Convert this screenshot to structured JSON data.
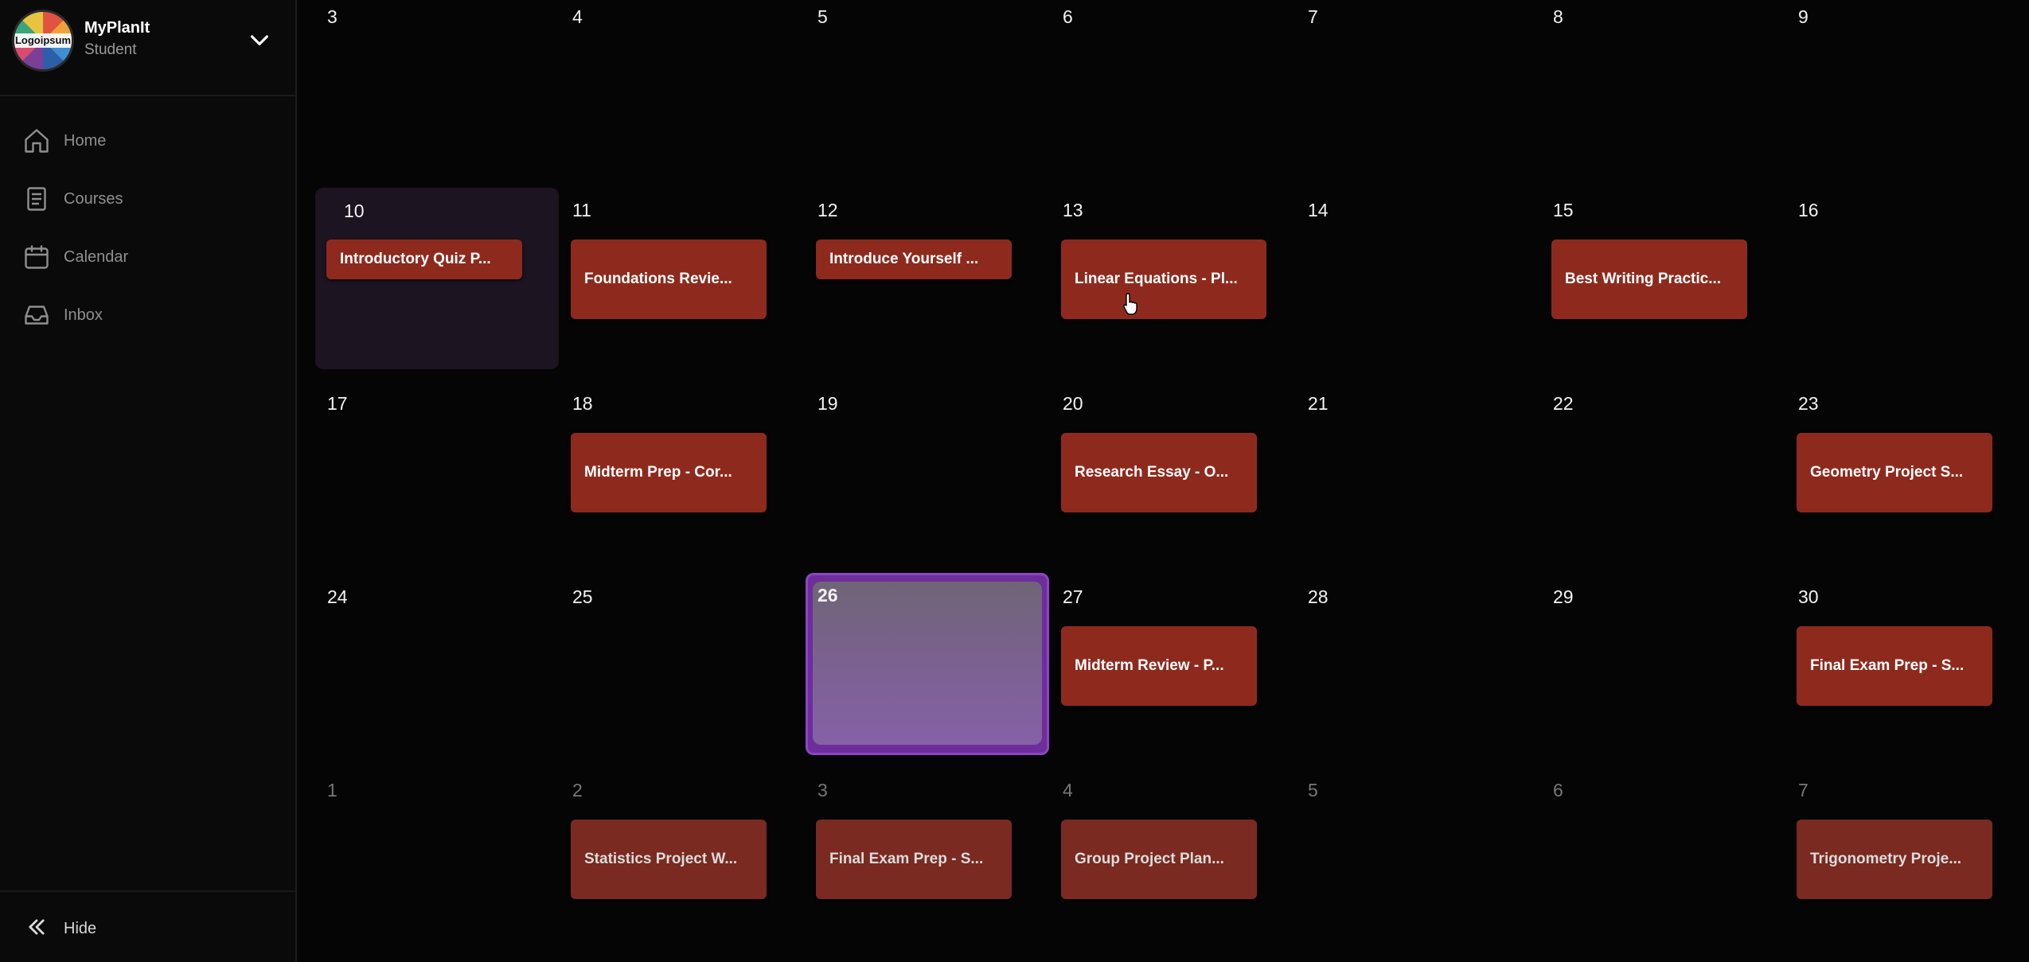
{
  "sidebar": {
    "brand": {
      "name": "MyPlanIt",
      "role": "Student",
      "logo_text": "Logoipsum"
    },
    "items": [
      {
        "label": "Home",
        "icon": "home-icon"
      },
      {
        "label": "Courses",
        "icon": "book-icon"
      },
      {
        "label": "Calendar",
        "icon": "calendar-icon"
      },
      {
        "label": "Inbox",
        "icon": "inbox-icon"
      }
    ],
    "hide_label": "Hide"
  },
  "calendar": {
    "rows": [
      {
        "days": [
          {
            "num": "3"
          },
          {
            "num": "4"
          },
          {
            "num": "5"
          },
          {
            "num": "6"
          },
          {
            "num": "7"
          },
          {
            "num": "8"
          },
          {
            "num": "9"
          }
        ]
      },
      {
        "days": [
          {
            "num": "10",
            "event": "Introductory Quiz P..."
          },
          {
            "num": "11",
            "event": "Foundations Revie..."
          },
          {
            "num": "12",
            "event": "Introduce Yourself ..."
          },
          {
            "num": "13",
            "event": "Linear Equations - Pl..."
          },
          {
            "num": "14"
          },
          {
            "num": "15",
            "event": "Best Writing Practic..."
          },
          {
            "num": "16"
          }
        ]
      },
      {
        "days": [
          {
            "num": "17"
          },
          {
            "num": "18",
            "event": "Midterm Prep - Cor..."
          },
          {
            "num": "19"
          },
          {
            "num": "20",
            "event": "Research Essay - O..."
          },
          {
            "num": "21"
          },
          {
            "num": "22"
          },
          {
            "num": "23",
            "event": "Geometry Project S..."
          }
        ]
      },
      {
        "days": [
          {
            "num": "24"
          },
          {
            "num": "25"
          },
          {
            "num": "26"
          },
          {
            "num": "27",
            "event": "Midterm Review - P..."
          },
          {
            "num": "28"
          },
          {
            "num": "29"
          },
          {
            "num": "30",
            "event": "Final Exam Prep - S..."
          }
        ]
      },
      {
        "days": [
          {
            "num": "1"
          },
          {
            "num": "2",
            "event": "Statistics Project W..."
          },
          {
            "num": "3",
            "event": "Final Exam Prep - S..."
          },
          {
            "num": "4",
            "event": "Group Project Plan..."
          },
          {
            "num": "5"
          },
          {
            "num": "6"
          },
          {
            "num": "7",
            "event": "Trigonometry Proje..."
          }
        ]
      }
    ]
  },
  "colors": {
    "event": "#8e2a1d",
    "today": "#6d2e9c",
    "highlight": "#1c1420",
    "background": "#050505"
  }
}
